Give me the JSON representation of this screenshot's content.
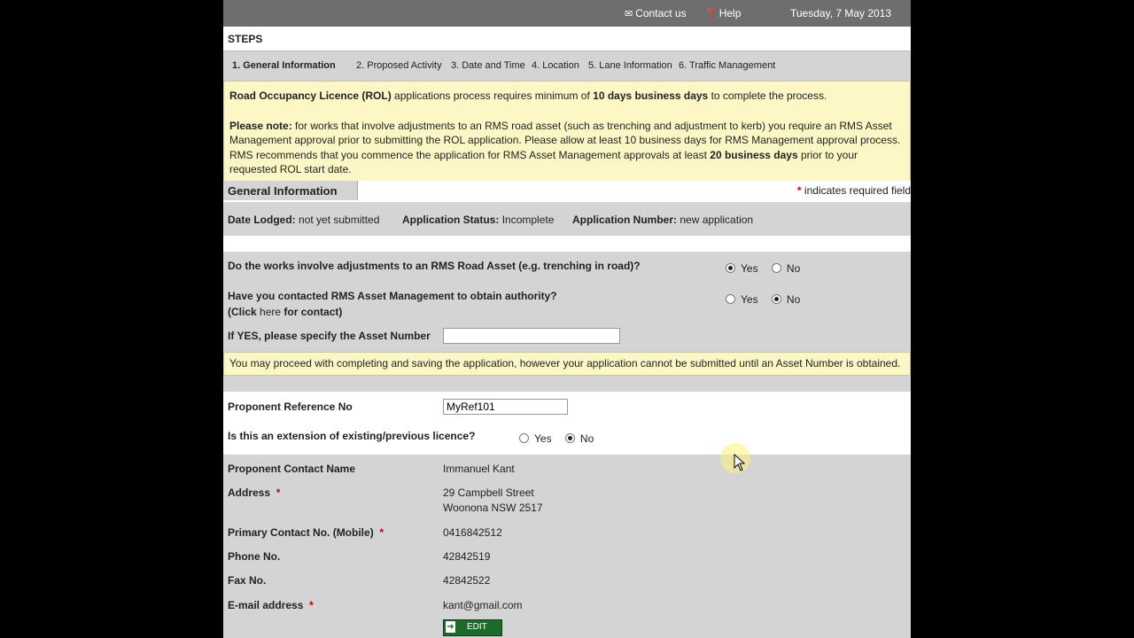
{
  "header": {
    "contact_label": "Contact us",
    "help_label": "Help",
    "date": "Tuesday, 7 May 2013"
  },
  "steps": {
    "title": "STEPS",
    "items": [
      "1. General Information",
      "2. Proposed Activity",
      "3. Date and Time",
      "4. Location",
      "5. Lane Information",
      "6. Traffic Management"
    ]
  },
  "notice": {
    "p1_bold": "Road Occupancy Licence (ROL)",
    "p1_mid": " applications process requires minimum of ",
    "p1_bold2": "10 days business days",
    "p1_end": " to complete the process.",
    "p2_bold": "Please note:",
    "p2_text": " for works that involve adjustments to an RMS road asset (such as trenching and adjustment to kerb) you require an RMS Asset Management approval prior to submitting the ROL application. Please allow at least 10 business days for RMS Management approval process. RMS recommends that you commence the application for RMS Asset Management approvals at least ",
    "p2_bold2": "20 business days",
    "p2_end": " prior to your requested ROL start date."
  },
  "section": {
    "title": "General Information",
    "required_note": " indicates required field",
    "star": "*"
  },
  "status": {
    "date_lodged_label": "Date Lodged:",
    "date_lodged_value": "not yet submitted",
    "app_status_label": "Application Status:",
    "app_status_value": "Incomplete",
    "app_number_label": "Application Number:",
    "app_number_value": "new application"
  },
  "asset": {
    "q1": "Do the works involve adjustments to an RMS Road Asset (e.g. trenching in road)?",
    "q1_selected": "Yes",
    "q2": "Have you contacted RMS Asset Management to obtain authority?",
    "q2_sub_pre": "(Click ",
    "q2_sub_link": "here",
    "q2_sub_post": " for contact)",
    "q2_selected": "No",
    "q3": "If YES, please specify the Asset Number",
    "asset_number_value": "",
    "yes": "Yes",
    "no": "No"
  },
  "warning": "You may proceed with completing and saving the application, however your application cannot be submitted until an Asset Number is obtained.",
  "proponent": {
    "ref_label": "Proponent Reference No",
    "ref_value": "MyRef101",
    "ext_label": "Is this an extension of existing/previous licence?",
    "ext_selected": "No"
  },
  "contact": {
    "name_label": "Proponent Contact Name",
    "name_value": "Immanuel Kant",
    "address_label": "Address",
    "address_line1": "29 Campbell Street",
    "address_line2": "Woonona NSW 2517",
    "mobile_label": "Primary Contact No. (Mobile)",
    "mobile_value": "0416842512",
    "phone_label": "Phone No.",
    "phone_value": "42842519",
    "fax_label": "Fax No.",
    "fax_value": "42842522",
    "email_label": "E-mail address",
    "email_value": "kant@gmail.com",
    "edit_label": "EDIT"
  },
  "colors": {
    "topbar": "#6e6e6e",
    "panel_gray": "#d4d4d4",
    "notice_yellow": "#fcf7c4",
    "required_red": "#cc0000",
    "edit_green": "#1e6a2a"
  }
}
